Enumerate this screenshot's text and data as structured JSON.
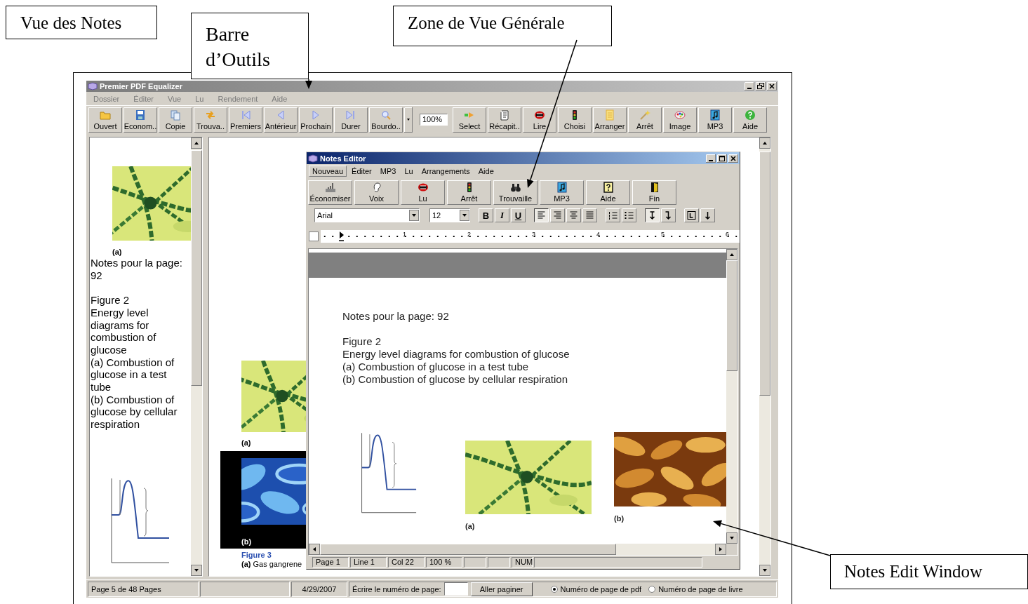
{
  "callouts": [
    {
      "text": "Vue des Notes"
    },
    {
      "text": "Barre d’Outils"
    },
    {
      "text": "Zone de Vue Générale"
    },
    {
      "text": "Notes Edit Window"
    }
  ],
  "app": {
    "title": "Premier PDF Equalizer",
    "menu": [
      "Dossier",
      "Éditer",
      "Vue",
      "Lu",
      "Rendement",
      "Aide"
    ],
    "toolbar": [
      {
        "label": "Ouvert"
      },
      {
        "label": "Econom.."
      },
      {
        "label": "Copie"
      },
      {
        "label": "Trouva.."
      },
      {
        "label": "Premiers"
      },
      {
        "label": "Antérieur"
      },
      {
        "label": "Prochain"
      },
      {
        "label": "Durer"
      },
      {
        "label": "Bourdo.."
      }
    ],
    "zoom": "100%",
    "toolbar_2": [
      {
        "label": "Select"
      },
      {
        "label": "Récapit.."
      },
      {
        "label": "Lire"
      },
      {
        "label": "Choisi"
      },
      {
        "label": "Arranger"
      },
      {
        "label": "Arrêt"
      },
      {
        "label": "Image"
      },
      {
        "label": "MP3"
      },
      {
        "label": "Aide"
      }
    ],
    "notes_view": {
      "caption": "(a)",
      "heading": "Notes pour la page: 92",
      "lines": [
        "Figure 2",
        "Energy level diagrams for combustion of glucose",
        "(a) Combustion of glucose in a test tube",
        "(b) Combustion of glucose by cellular respiration"
      ]
    },
    "page_view": {
      "caption_a": "(a)",
      "caption_b": "(b)",
      "figure_title": "Figure 3",
      "figure_text": "**(a)** Gas gangrene"
    },
    "status_bar": {
      "page": "Page 5 de 48 Pages",
      "date": "4/29/2007",
      "goto_label": "Écrire le numéro de page:",
      "goto_button": "Aller paginer",
      "options": [
        {
          "label": "Numéro de page de pdf",
          "selected": true
        },
        {
          "label": "Numéro de page de livre",
          "selected": false
        }
      ]
    }
  },
  "notes_editor": {
    "title": "Notes Editor",
    "menu": [
      {
        "label": "Nouveau",
        "selected": true
      },
      {
        "label": "Éditer",
        "selected": false
      },
      {
        "label": "MP3",
        "selected": false
      },
      {
        "label": "Lu",
        "selected": false
      },
      {
        "label": "Arrangements",
        "selected": false
      },
      {
        "label": "Aide",
        "selected": false
      }
    ],
    "toolbar": [
      {
        "label": "Économiser"
      },
      {
        "label": "Voix"
      },
      {
        "label": "Lu"
      },
      {
        "label": "Arrêt"
      },
      {
        "label": "Trouvaille"
      },
      {
        "label": "MP3"
      },
      {
        "label": "Aide"
      },
      {
        "label": "Fin"
      }
    ],
    "font": "Arial",
    "size": "12",
    "format_groups": [
      [
        {
          "kind": "bold",
          "label": "B"
        },
        {
          "kind": "italic",
          "label": "I"
        },
        {
          "kind": "underline",
          "label": "U"
        }
      ],
      [
        {
          "kind": "align-left",
          "selected": true
        },
        {
          "kind": "align-right",
          "selected": false
        },
        {
          "kind": "align-center",
          "selected": false
        },
        {
          "kind": "justify",
          "selected": false
        }
      ],
      [
        {
          "kind": "numbered-list"
        },
        {
          "kind": "bullet-list"
        }
      ],
      [
        {
          "kind": "arrow-down-left",
          "selected": true
        },
        {
          "kind": "arrow-down-right",
          "selected": false
        }
      ],
      [
        {
          "kind": "tab-stop"
        },
        {
          "kind": "arrow-down"
        }
      ]
    ],
    "ruler": [
      "1",
      "2",
      "3",
      "4",
      "5",
      "6"
    ],
    "body": {
      "heading": "Notes pour la page: 92",
      "lines": [
        "Figure 2",
        "Energy level diagrams for combustion of glucose",
        "(a) Combustion of glucose in a test tube",
        "(b) Combustion of glucose by cellular respiration"
      ],
      "caption_a": "(a)",
      "caption_b": "(b)"
    },
    "status": [
      "Page 1",
      "Line 1",
      "Col 22",
      "100 %"
    ],
    "status_num": "NUM"
  }
}
